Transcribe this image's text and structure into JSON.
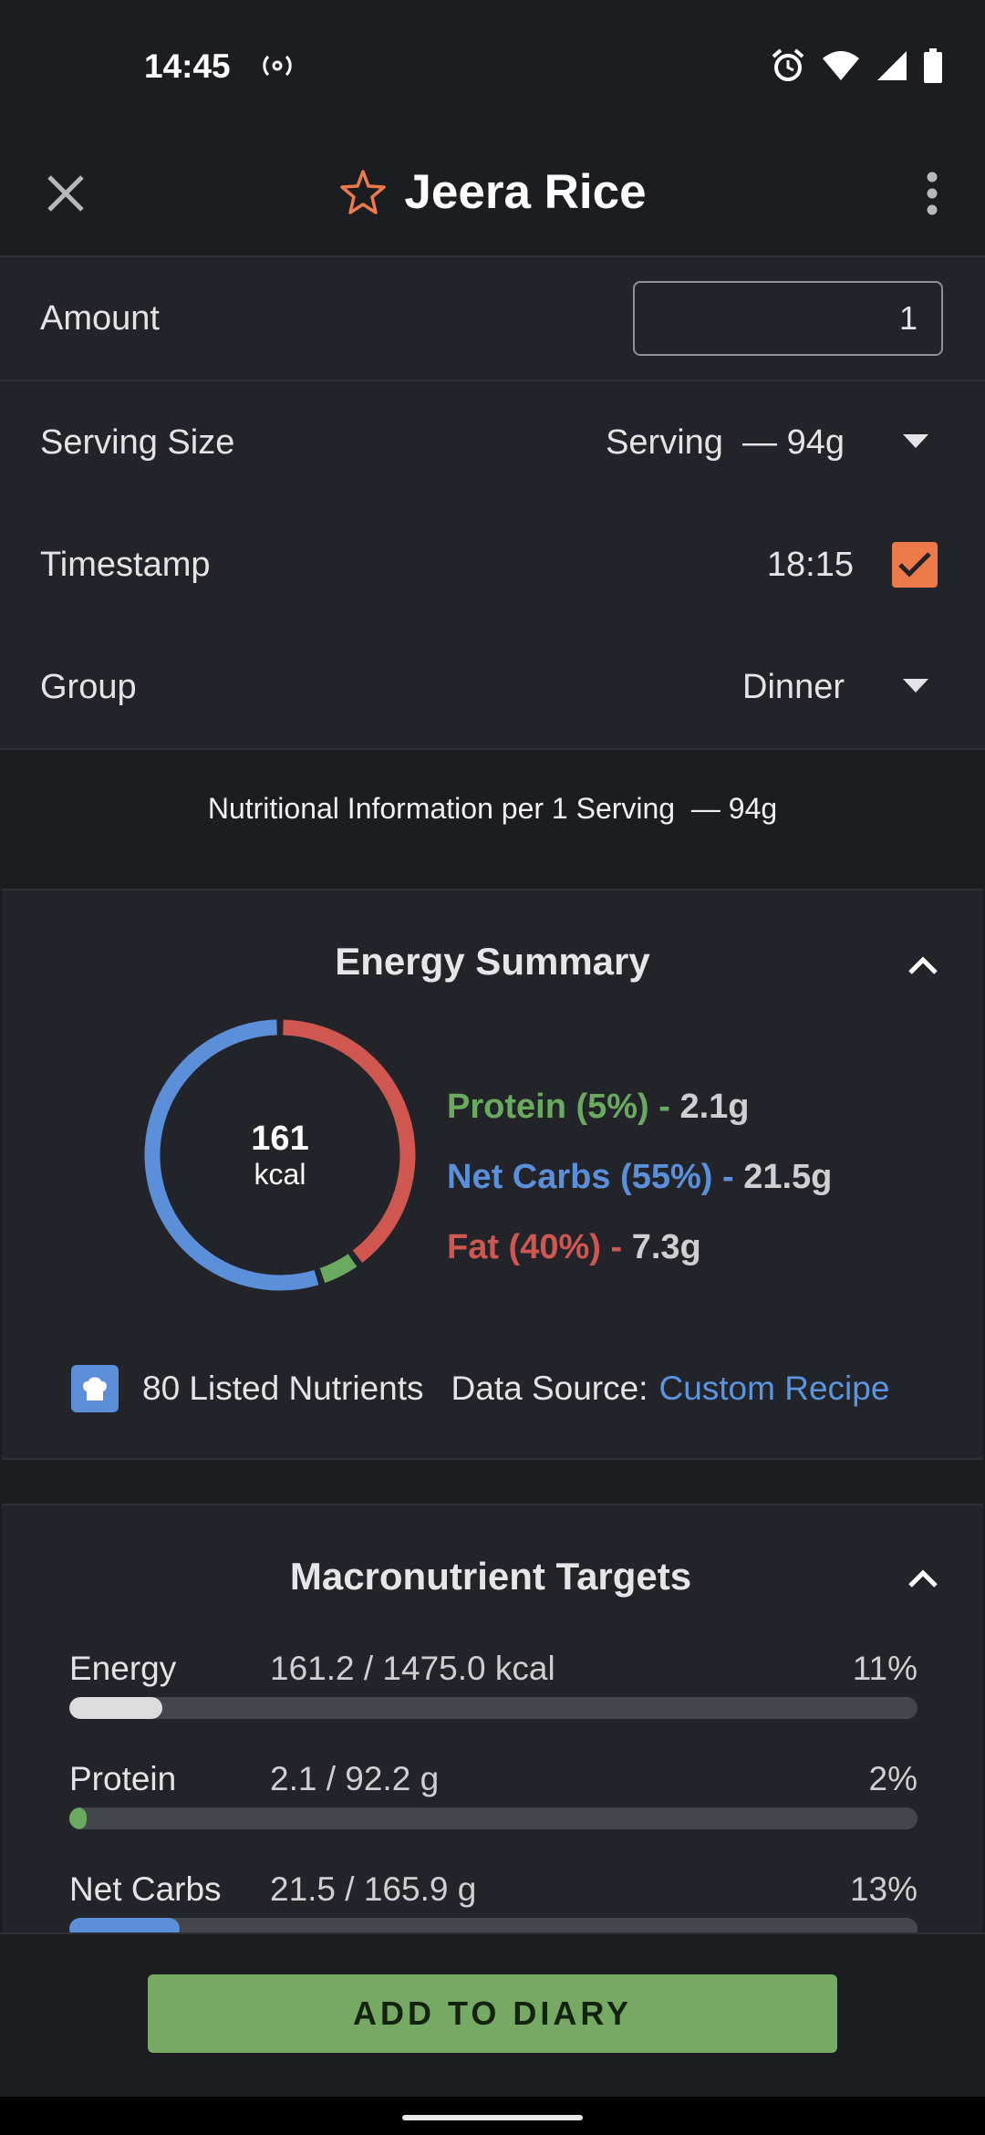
{
  "status": {
    "time": "14:45"
  },
  "header": {
    "title": "Jeera Rice"
  },
  "form": {
    "amount_label": "Amount",
    "amount_value": "1",
    "serving_label": "Serving Size",
    "serving_value": "Serving  — 94g",
    "timestamp_label": "Timestamp",
    "timestamp_value": "18:15",
    "timestamp_checked": true,
    "group_label": "Group",
    "group_value": "Dinner"
  },
  "nutrition_info": "Nutritional Information per 1 Serving  — 94g",
  "energy_summary": {
    "title": "Energy Summary",
    "kcal": "161",
    "kcal_unit": "kcal",
    "protein_label": "Protein (5%) - ",
    "protein_amount": "2.1g",
    "carbs_label": "Net Carbs (55%) - ",
    "carbs_amount": "21.5g",
    "fat_label": "Fat (40%) - ",
    "fat_amount": "7.3g",
    "segments": {
      "protein_pct": 5,
      "carbs_pct": 55,
      "fat_pct": 40
    },
    "nutrients_count": "80 Listed Nutrients",
    "data_source_label": "Data Source:",
    "data_source_value": "Custom Recipe"
  },
  "targets": {
    "title": "Macronutrient Targets",
    "items": [
      {
        "name": "Energy",
        "value": "161.2 / 1475.0 kcal",
        "pct": "11%",
        "fraction": 0.11,
        "color": "#dcdcdc"
      },
      {
        "name": "Protein",
        "value": "2.1 / 92.2 g",
        "pct": "2%",
        "fraction": 0.02,
        "color": "#6aaa5f"
      },
      {
        "name": "Net Carbs",
        "value": "21.5 / 165.9 g",
        "pct": "13%",
        "fraction": 0.13,
        "color": "#5b8fd9"
      }
    ]
  },
  "footer": {
    "add_button": "ADD TO DIARY"
  },
  "colors": {
    "accent": "#ec7a4b",
    "protein": "#6aaa5f",
    "carbs": "#5b8fd9",
    "fat": "#cf574f",
    "link": "#5b95e0",
    "button": "#76a964"
  }
}
